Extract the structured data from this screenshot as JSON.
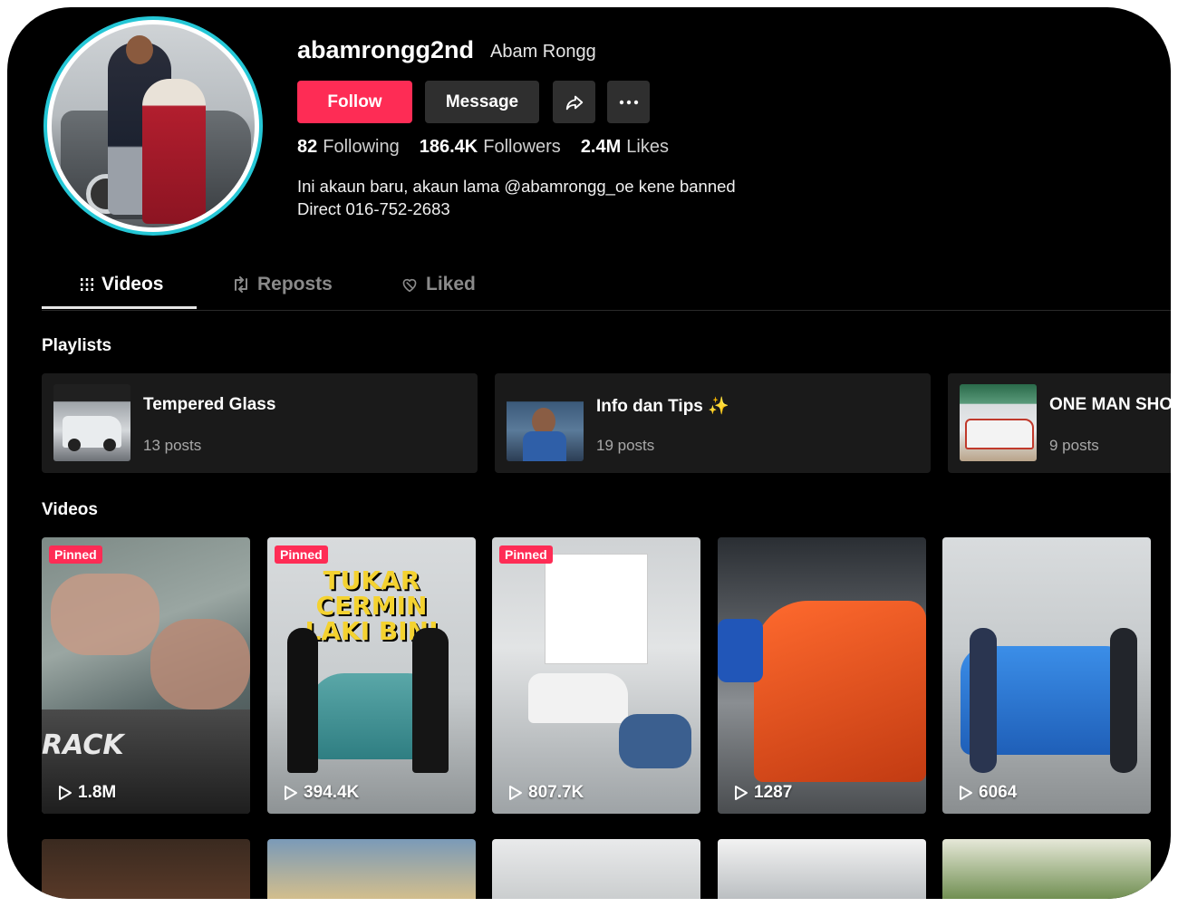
{
  "profile": {
    "username": "abamrongg2nd",
    "nickname": "Abam Rongg",
    "follow_label": "Follow",
    "message_label": "Message",
    "following_count": "82",
    "following_label": "Following",
    "followers_count": "186.4K",
    "followers_label": "Followers",
    "likes_count": "2.4M",
    "likes_label": "Likes",
    "bio_line1": "Ini akaun baru, akaun lama @abamrongg_oe kene banned",
    "bio_line2": "Direct 016-752-2683",
    "avatar_ring_color": "#25c7d6"
  },
  "tabs": [
    {
      "label": "Videos",
      "icon": "grid-icon",
      "active": true
    },
    {
      "label": "Reposts",
      "icon": "repost-icon",
      "active": false
    },
    {
      "label": "Liked",
      "icon": "heart-icon",
      "active": false
    }
  ],
  "playlists_title": "Playlists",
  "playlists": [
    {
      "title": "Tempered Glass",
      "posts": "13 posts"
    },
    {
      "title": "Info dan Tips ✨",
      "posts": "19 posts"
    },
    {
      "title": "ONE MAN SHO",
      "posts": "9 posts"
    }
  ],
  "videos_title": "Videos",
  "videos": [
    {
      "pinned": "Pinned",
      "views": "1.8M",
      "overlay": "RACK"
    },
    {
      "pinned": "Pinned",
      "views": "394.4K",
      "overlay_line1": "TUKAR CERMIN",
      "overlay_line2": "LAKI BINI"
    },
    {
      "pinned": "Pinned",
      "views": "807.7K"
    },
    {
      "views": "1287"
    },
    {
      "views": "6064"
    }
  ],
  "colors": {
    "accent": "#fe2c55",
    "background": "#000000",
    "card": "#1a1a1a"
  }
}
